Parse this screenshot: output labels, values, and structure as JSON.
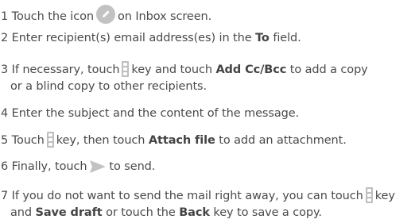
{
  "steps": [
    {
      "num": "1",
      "a": "Touch the icon",
      "b": "on Inbox screen."
    },
    {
      "num": "2",
      "a": "Enter recipient(s) email address(es) in the",
      "bold": "To",
      "b": "field."
    },
    {
      "num": "3",
      "a": "If necessary, touch",
      "b": "key and touch",
      "bold": "Add Cc/Bcc",
      "c": "to add a copy",
      "line2": "or a blind copy to other recipients."
    },
    {
      "num": "4",
      "a": "Enter the subject and the content of the message."
    },
    {
      "num": "5",
      "a": "Touch",
      "b": "key, then touch",
      "bold": "Attach file",
      "c": "to add an attachment."
    },
    {
      "num": "6",
      "a": "Finally, touch",
      "b": "to send."
    },
    {
      "num": "7",
      "a": "If you do not want to send the mail right away, you can touch",
      "b": "key",
      "line2_a": "and",
      "bold1": "Save draft",
      "line2_b": "or touch the",
      "bold2": "Back",
      "line2_c": "key to save a copy."
    }
  ],
  "icons": {
    "compose": "pencil-icon",
    "menu_key": "menu-key-icon",
    "send": "send-icon",
    "accent": "#bfbfbf"
  }
}
